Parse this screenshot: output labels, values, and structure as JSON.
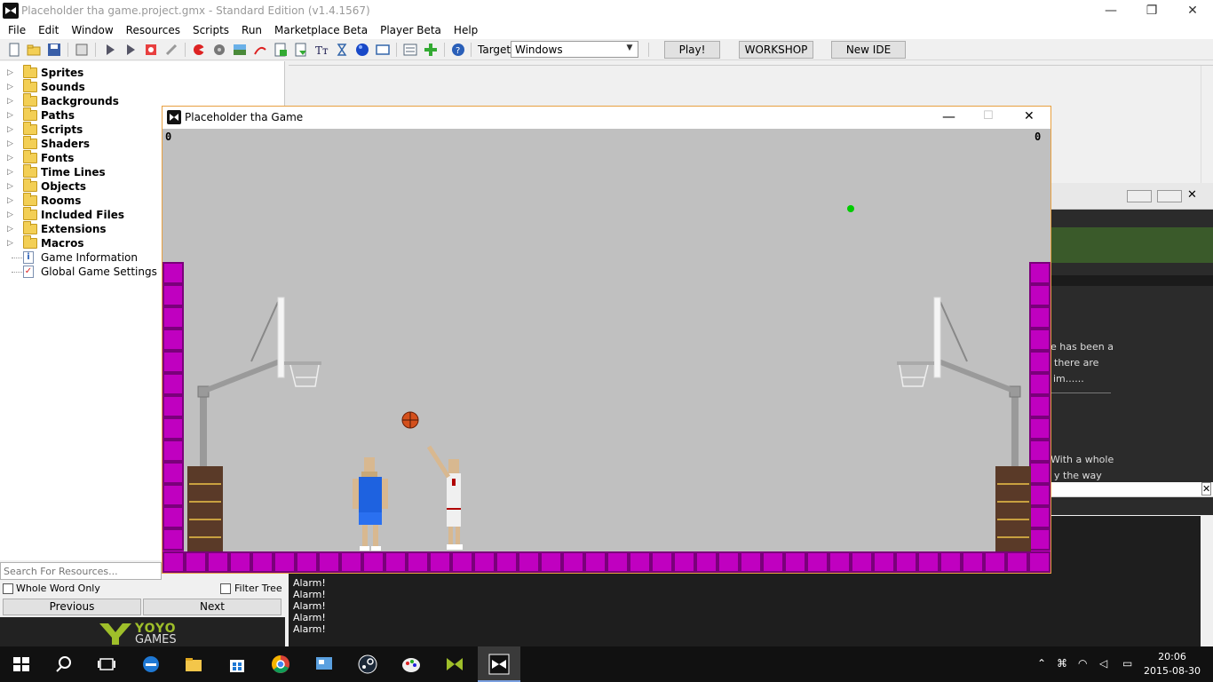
{
  "ide": {
    "title": "Placeholder tha game.project.gmx  -  Standard Edition (v1.4.1567)",
    "menu": [
      "File",
      "Edit",
      "Window",
      "Resources",
      "Scripts",
      "Run",
      "Marketplace Beta",
      "Player Beta",
      "Help"
    ],
    "toolbar": {
      "target_label": "Target:",
      "target_value": "Windows",
      "play_label": "Play!",
      "workshop_label": "WORKSHOP",
      "newide_label": "New IDE"
    }
  },
  "tree": {
    "folders": [
      "Sprites",
      "Sounds",
      "Backgrounds",
      "Paths",
      "Scripts",
      "Shaders",
      "Fonts",
      "Time Lines",
      "Objects",
      "Rooms",
      "Included Files",
      "Extensions",
      "Macros"
    ],
    "items": [
      "Game Information",
      "Global Game Settings"
    ]
  },
  "search": {
    "placeholder": "Search For Resources...",
    "whole_word": "Whole Word Only",
    "filter_tree": "Filter Tree",
    "previous": "Previous",
    "next": "Next"
  },
  "brand": {
    "yoyo_top": "YOYO",
    "yoyo_bottom": "GAMES"
  },
  "room_text": [
    "e has been a",
    "there are",
    "im......",
    "With a whole",
    "y the way"
  ],
  "output": [
    "Alarm!",
    "Alarm!",
    "Alarm!",
    "Alarm!",
    "Alarm!"
  ],
  "game": {
    "title": "Placeholder tha Game",
    "score_left": "0",
    "score_right": "0",
    "colors": {
      "floor": "#c000c0",
      "court": "#c0c0c0",
      "player_blue": "#1e62e0",
      "ball": "#d4501c"
    }
  },
  "taskbar": {
    "time": "20:06",
    "date": "2015-08-30"
  }
}
